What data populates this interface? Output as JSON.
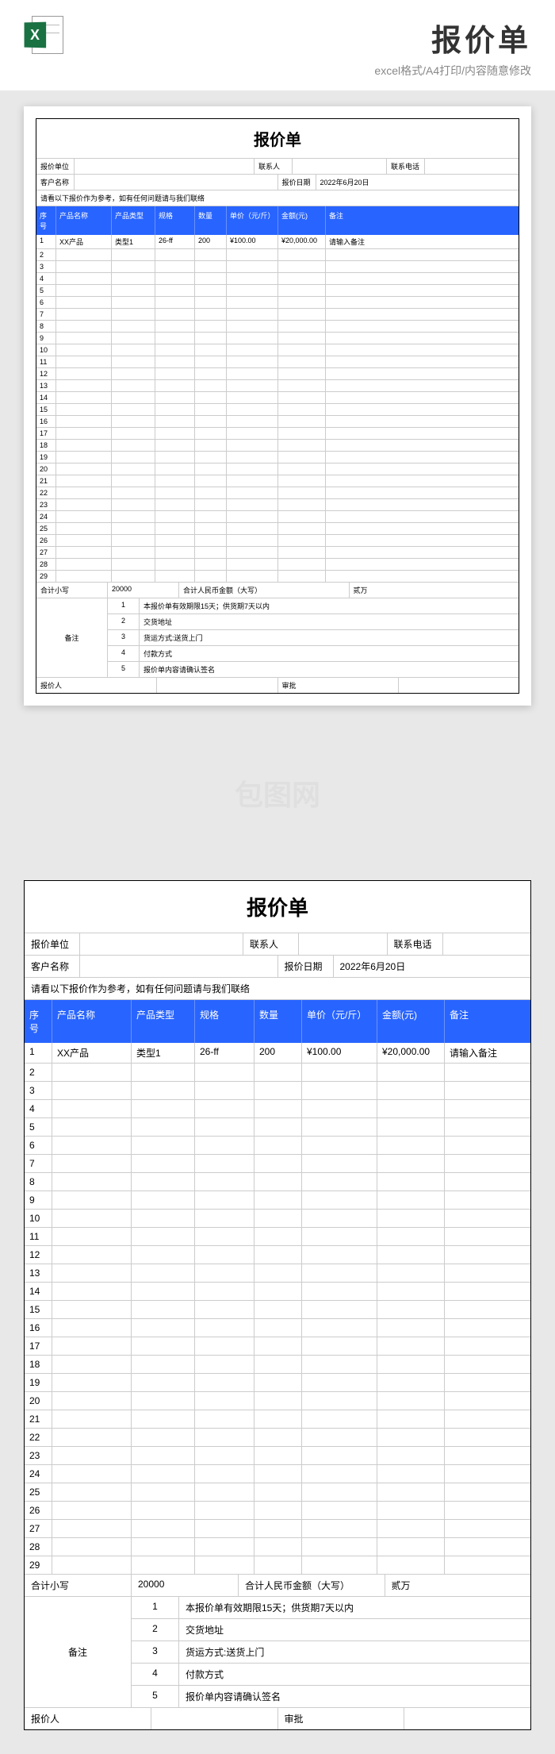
{
  "header": {
    "title": "报价单",
    "subtitle": "excel格式/A4打印/内容随意修改",
    "icon_letter": "X"
  },
  "watermark": "包图网",
  "doc": {
    "title": "报价单",
    "info": {
      "quote_unit_label": "报价单位",
      "quote_unit": "",
      "contact_label": "联系人",
      "contact": "",
      "phone_label": "联系电话",
      "phone": "",
      "customer_label": "客户名称",
      "customer": "",
      "date_label": "报价日期",
      "date": "2022年6月20日"
    },
    "note": "请看以下报价作为参考，如有任何问题请与我们联络",
    "columns": {
      "seq": "序号",
      "name": "产品名称",
      "type": "产品类型",
      "spec": "规格",
      "qty": "数量",
      "price": "单价（元/斤）",
      "amount": "金额(元)",
      "remark": "备注"
    },
    "rows": [
      {
        "seq": "1",
        "name": "XX产品",
        "type": "类型1",
        "spec": "26-ff",
        "qty": "200",
        "price": "¥100.00",
        "amount": "¥20,000.00",
        "remark": "请输入备注"
      },
      {
        "seq": "2",
        "name": "",
        "type": "",
        "spec": "",
        "qty": "",
        "price": "",
        "amount": "",
        "remark": ""
      },
      {
        "seq": "3",
        "name": "",
        "type": "",
        "spec": "",
        "qty": "",
        "price": "",
        "amount": "",
        "remark": ""
      },
      {
        "seq": "4",
        "name": "",
        "type": "",
        "spec": "",
        "qty": "",
        "price": "",
        "amount": "",
        "remark": ""
      },
      {
        "seq": "5",
        "name": "",
        "type": "",
        "spec": "",
        "qty": "",
        "price": "",
        "amount": "",
        "remark": ""
      },
      {
        "seq": "6",
        "name": "",
        "type": "",
        "spec": "",
        "qty": "",
        "price": "",
        "amount": "",
        "remark": ""
      },
      {
        "seq": "7",
        "name": "",
        "type": "",
        "spec": "",
        "qty": "",
        "price": "",
        "amount": "",
        "remark": ""
      },
      {
        "seq": "8",
        "name": "",
        "type": "",
        "spec": "",
        "qty": "",
        "price": "",
        "amount": "",
        "remark": ""
      },
      {
        "seq": "9",
        "name": "",
        "type": "",
        "spec": "",
        "qty": "",
        "price": "",
        "amount": "",
        "remark": ""
      },
      {
        "seq": "10",
        "name": "",
        "type": "",
        "spec": "",
        "qty": "",
        "price": "",
        "amount": "",
        "remark": ""
      },
      {
        "seq": "11",
        "name": "",
        "type": "",
        "spec": "",
        "qty": "",
        "price": "",
        "amount": "",
        "remark": ""
      },
      {
        "seq": "12",
        "name": "",
        "type": "",
        "spec": "",
        "qty": "",
        "price": "",
        "amount": "",
        "remark": ""
      },
      {
        "seq": "13",
        "name": "",
        "type": "",
        "spec": "",
        "qty": "",
        "price": "",
        "amount": "",
        "remark": ""
      },
      {
        "seq": "14",
        "name": "",
        "type": "",
        "spec": "",
        "qty": "",
        "price": "",
        "amount": "",
        "remark": ""
      },
      {
        "seq": "15",
        "name": "",
        "type": "",
        "spec": "",
        "qty": "",
        "price": "",
        "amount": "",
        "remark": ""
      },
      {
        "seq": "16",
        "name": "",
        "type": "",
        "spec": "",
        "qty": "",
        "price": "",
        "amount": "",
        "remark": ""
      },
      {
        "seq": "17",
        "name": "",
        "type": "",
        "spec": "",
        "qty": "",
        "price": "",
        "amount": "",
        "remark": ""
      },
      {
        "seq": "18",
        "name": "",
        "type": "",
        "spec": "",
        "qty": "",
        "price": "",
        "amount": "",
        "remark": ""
      },
      {
        "seq": "19",
        "name": "",
        "type": "",
        "spec": "",
        "qty": "",
        "price": "",
        "amount": "",
        "remark": ""
      },
      {
        "seq": "20",
        "name": "",
        "type": "",
        "spec": "",
        "qty": "",
        "price": "",
        "amount": "",
        "remark": ""
      },
      {
        "seq": "21",
        "name": "",
        "type": "",
        "spec": "",
        "qty": "",
        "price": "",
        "amount": "",
        "remark": ""
      },
      {
        "seq": "22",
        "name": "",
        "type": "",
        "spec": "",
        "qty": "",
        "price": "",
        "amount": "",
        "remark": ""
      },
      {
        "seq": "23",
        "name": "",
        "type": "",
        "spec": "",
        "qty": "",
        "price": "",
        "amount": "",
        "remark": ""
      },
      {
        "seq": "24",
        "name": "",
        "type": "",
        "spec": "",
        "qty": "",
        "price": "",
        "amount": "",
        "remark": ""
      },
      {
        "seq": "25",
        "name": "",
        "type": "",
        "spec": "",
        "qty": "",
        "price": "",
        "amount": "",
        "remark": ""
      },
      {
        "seq": "26",
        "name": "",
        "type": "",
        "spec": "",
        "qty": "",
        "price": "",
        "amount": "",
        "remark": ""
      },
      {
        "seq": "27",
        "name": "",
        "type": "",
        "spec": "",
        "qty": "",
        "price": "",
        "amount": "",
        "remark": ""
      },
      {
        "seq": "28",
        "name": "",
        "type": "",
        "spec": "",
        "qty": "",
        "price": "",
        "amount": "",
        "remark": ""
      },
      {
        "seq": "29",
        "name": "",
        "type": "",
        "spec": "",
        "qty": "",
        "price": "",
        "amount": "",
        "remark": ""
      }
    ],
    "summary": {
      "subtotal_label": "合计小写",
      "subtotal": "20000",
      "total_cn_label": "合计人民币金额（大写）",
      "total_cn": "贰万"
    },
    "remarks": {
      "label": "备注",
      "items": [
        {
          "num": "1",
          "text": "本报价单有效期限15天；供货期7天以内"
        },
        {
          "num": "2",
          "text": "交货地址"
        },
        {
          "num": "3",
          "text": "货运方式:送货上门"
        },
        {
          "num": "4",
          "text": "付款方式"
        },
        {
          "num": "5",
          "text": "报价单内容请确认签名"
        }
      ]
    },
    "footer": {
      "quoter_label": "报价人",
      "quoter": "",
      "approver_label": "审批",
      "approver": ""
    }
  }
}
